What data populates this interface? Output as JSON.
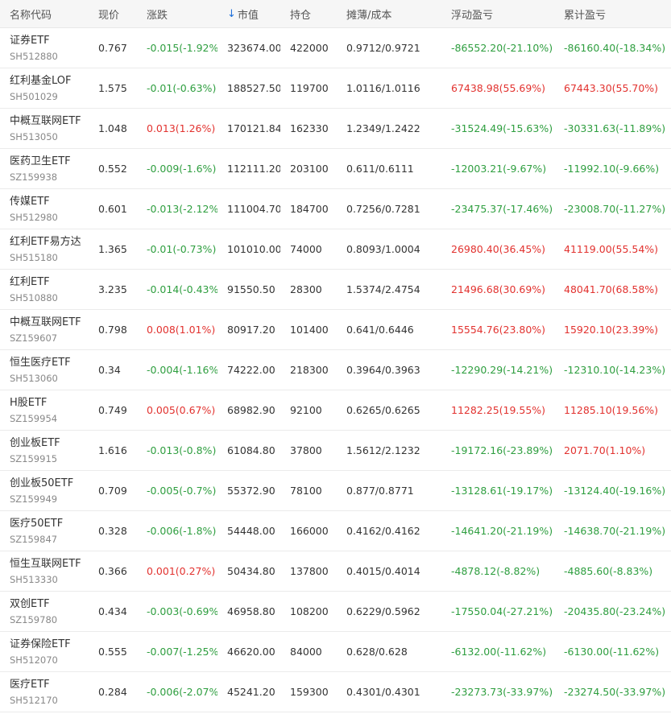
{
  "columns": {
    "name_code": "名称代码",
    "price": "现价",
    "change": "涨跌",
    "market_value": "市值",
    "holdings": "持仓",
    "cost": "摊薄/成本",
    "floating_pl": "浮动盈亏",
    "cumulative_pl": "累计盈亏"
  },
  "sort_icon": "arrow-down-icon",
  "colors": {
    "up": "#e2322f",
    "down": "#2e9e3f",
    "sort": "#1e6fd9"
  },
  "rows": [
    {
      "name": "证券ETF",
      "code": "SH512880",
      "price": "0.767",
      "change": "-0.015(-1.92%)",
      "change_dir": "down",
      "market_value": "323674.00",
      "holdings": "422000",
      "cost": "0.9712/0.9721",
      "floating": "-86552.20(-21.10%)",
      "floating_dir": "down",
      "cumulative": "-86160.40(-18.34%)",
      "cumulative_dir": "down"
    },
    {
      "name": "红利基金LOF",
      "code": "SH501029",
      "price": "1.575",
      "change": "-0.01(-0.63%)",
      "change_dir": "down",
      "market_value": "188527.50",
      "holdings": "119700",
      "cost": "1.0116/1.0116",
      "floating": "67438.98(55.69%)",
      "floating_dir": "up",
      "cumulative": "67443.30(55.70%)",
      "cumulative_dir": "up"
    },
    {
      "name": "中概互联网ETF",
      "code": "SH513050",
      "price": "1.048",
      "change": "0.013(1.26%)",
      "change_dir": "up",
      "market_value": "170121.84",
      "holdings": "162330",
      "cost": "1.2349/1.2422",
      "floating": "-31524.49(-15.63%)",
      "floating_dir": "down",
      "cumulative": "-30331.63(-11.89%)",
      "cumulative_dir": "down"
    },
    {
      "name": "医药卫生ETF",
      "code": "SZ159938",
      "price": "0.552",
      "change": "-0.009(-1.6%)",
      "change_dir": "down",
      "market_value": "112111.20",
      "holdings": "203100",
      "cost": "0.611/0.6111",
      "floating": "-12003.21(-9.67%)",
      "floating_dir": "down",
      "cumulative": "-11992.10(-9.66%)",
      "cumulative_dir": "down"
    },
    {
      "name": "传媒ETF",
      "code": "SH512980",
      "price": "0.601",
      "change": "-0.013(-2.12%)",
      "change_dir": "down",
      "market_value": "111004.70",
      "holdings": "184700",
      "cost": "0.7256/0.7281",
      "floating": "-23475.37(-17.46%)",
      "floating_dir": "down",
      "cumulative": "-23008.70(-11.27%)",
      "cumulative_dir": "down"
    },
    {
      "name": "红利ETF易方达",
      "code": "SH515180",
      "price": "1.365",
      "change": "-0.01(-0.73%)",
      "change_dir": "down",
      "market_value": "101010.00",
      "holdings": "74000",
      "cost": "0.8093/1.0004",
      "floating": "26980.40(36.45%)",
      "floating_dir": "up",
      "cumulative": "41119.00(55.54%)",
      "cumulative_dir": "up"
    },
    {
      "name": "红利ETF",
      "code": "SH510880",
      "price": "3.235",
      "change": "-0.014(-0.43%)",
      "change_dir": "down",
      "market_value": "91550.50",
      "holdings": "28300",
      "cost": "1.5374/2.4754",
      "floating": "21496.68(30.69%)",
      "floating_dir": "up",
      "cumulative": "48041.70(68.58%)",
      "cumulative_dir": "up"
    },
    {
      "name": "中概互联网ETF",
      "code": "SZ159607",
      "price": "0.798",
      "change": "0.008(1.01%)",
      "change_dir": "up",
      "market_value": "80917.20",
      "holdings": "101400",
      "cost": "0.641/0.6446",
      "floating": "15554.76(23.80%)",
      "floating_dir": "up",
      "cumulative": "15920.10(23.39%)",
      "cumulative_dir": "up"
    },
    {
      "name": "恒生医疗ETF",
      "code": "SH513060",
      "price": "0.34",
      "change": "-0.004(-1.16%)",
      "change_dir": "down",
      "market_value": "74222.00",
      "holdings": "218300",
      "cost": "0.3964/0.3963",
      "floating": "-12290.29(-14.21%)",
      "floating_dir": "down",
      "cumulative": "-12310.10(-14.23%)",
      "cumulative_dir": "down"
    },
    {
      "name": "H股ETF",
      "code": "SZ159954",
      "price": "0.749",
      "change": "0.005(0.67%)",
      "change_dir": "up",
      "market_value": "68982.90",
      "holdings": "92100",
      "cost": "0.6265/0.6265",
      "floating": "11282.25(19.55%)",
      "floating_dir": "up",
      "cumulative": "11285.10(19.56%)",
      "cumulative_dir": "up"
    },
    {
      "name": "创业板ETF",
      "code": "SZ159915",
      "price": "1.616",
      "change": "-0.013(-0.8%)",
      "change_dir": "down",
      "market_value": "61084.80",
      "holdings": "37800",
      "cost": "1.5612/2.1232",
      "floating": "-19172.16(-23.89%)",
      "floating_dir": "down",
      "cumulative": "2071.70(1.10%)",
      "cumulative_dir": "up"
    },
    {
      "name": "创业板50ETF",
      "code": "SZ159949",
      "price": "0.709",
      "change": "-0.005(-0.7%)",
      "change_dir": "down",
      "market_value": "55372.90",
      "holdings": "78100",
      "cost": "0.877/0.8771",
      "floating": "-13128.61(-19.17%)",
      "floating_dir": "down",
      "cumulative": "-13124.40(-19.16%)",
      "cumulative_dir": "down"
    },
    {
      "name": "医疗50ETF",
      "code": "SZ159847",
      "price": "0.328",
      "change": "-0.006(-1.8%)",
      "change_dir": "down",
      "market_value": "54448.00",
      "holdings": "166000",
      "cost": "0.4162/0.4162",
      "floating": "-14641.20(-21.19%)",
      "floating_dir": "down",
      "cumulative": "-14638.70(-21.19%)",
      "cumulative_dir": "down"
    },
    {
      "name": "恒生互联网ETF",
      "code": "SH513330",
      "price": "0.366",
      "change": "0.001(0.27%)",
      "change_dir": "up",
      "market_value": "50434.80",
      "holdings": "137800",
      "cost": "0.4015/0.4014",
      "floating": "-4878.12(-8.82%)",
      "floating_dir": "down",
      "cumulative": "-4885.60(-8.83%)",
      "cumulative_dir": "down"
    },
    {
      "name": "双创ETF",
      "code": "SZ159780",
      "price": "0.434",
      "change": "-0.003(-0.69%)",
      "change_dir": "down",
      "market_value": "46958.80",
      "holdings": "108200",
      "cost": "0.6229/0.5962",
      "floating": "-17550.04(-27.21%)",
      "floating_dir": "down",
      "cumulative": "-20435.80(-23.24%)",
      "cumulative_dir": "down"
    },
    {
      "name": "证券保险ETF",
      "code": "SH512070",
      "price": "0.555",
      "change": "-0.007(-1.25%)",
      "change_dir": "down",
      "market_value": "46620.00",
      "holdings": "84000",
      "cost": "0.628/0.628",
      "floating": "-6132.00(-11.62%)",
      "floating_dir": "down",
      "cumulative": "-6130.00(-11.62%)",
      "cumulative_dir": "down"
    },
    {
      "name": "医疗ETF",
      "code": "SH512170",
      "price": "0.284",
      "change": "-0.006(-2.07%)",
      "change_dir": "down",
      "market_value": "45241.20",
      "holdings": "159300",
      "cost": "0.4301/0.4301",
      "floating": "-23273.73(-33.97%)",
      "floating_dir": "down",
      "cumulative": "-23274.50(-33.97%)",
      "cumulative_dir": "down"
    }
  ]
}
